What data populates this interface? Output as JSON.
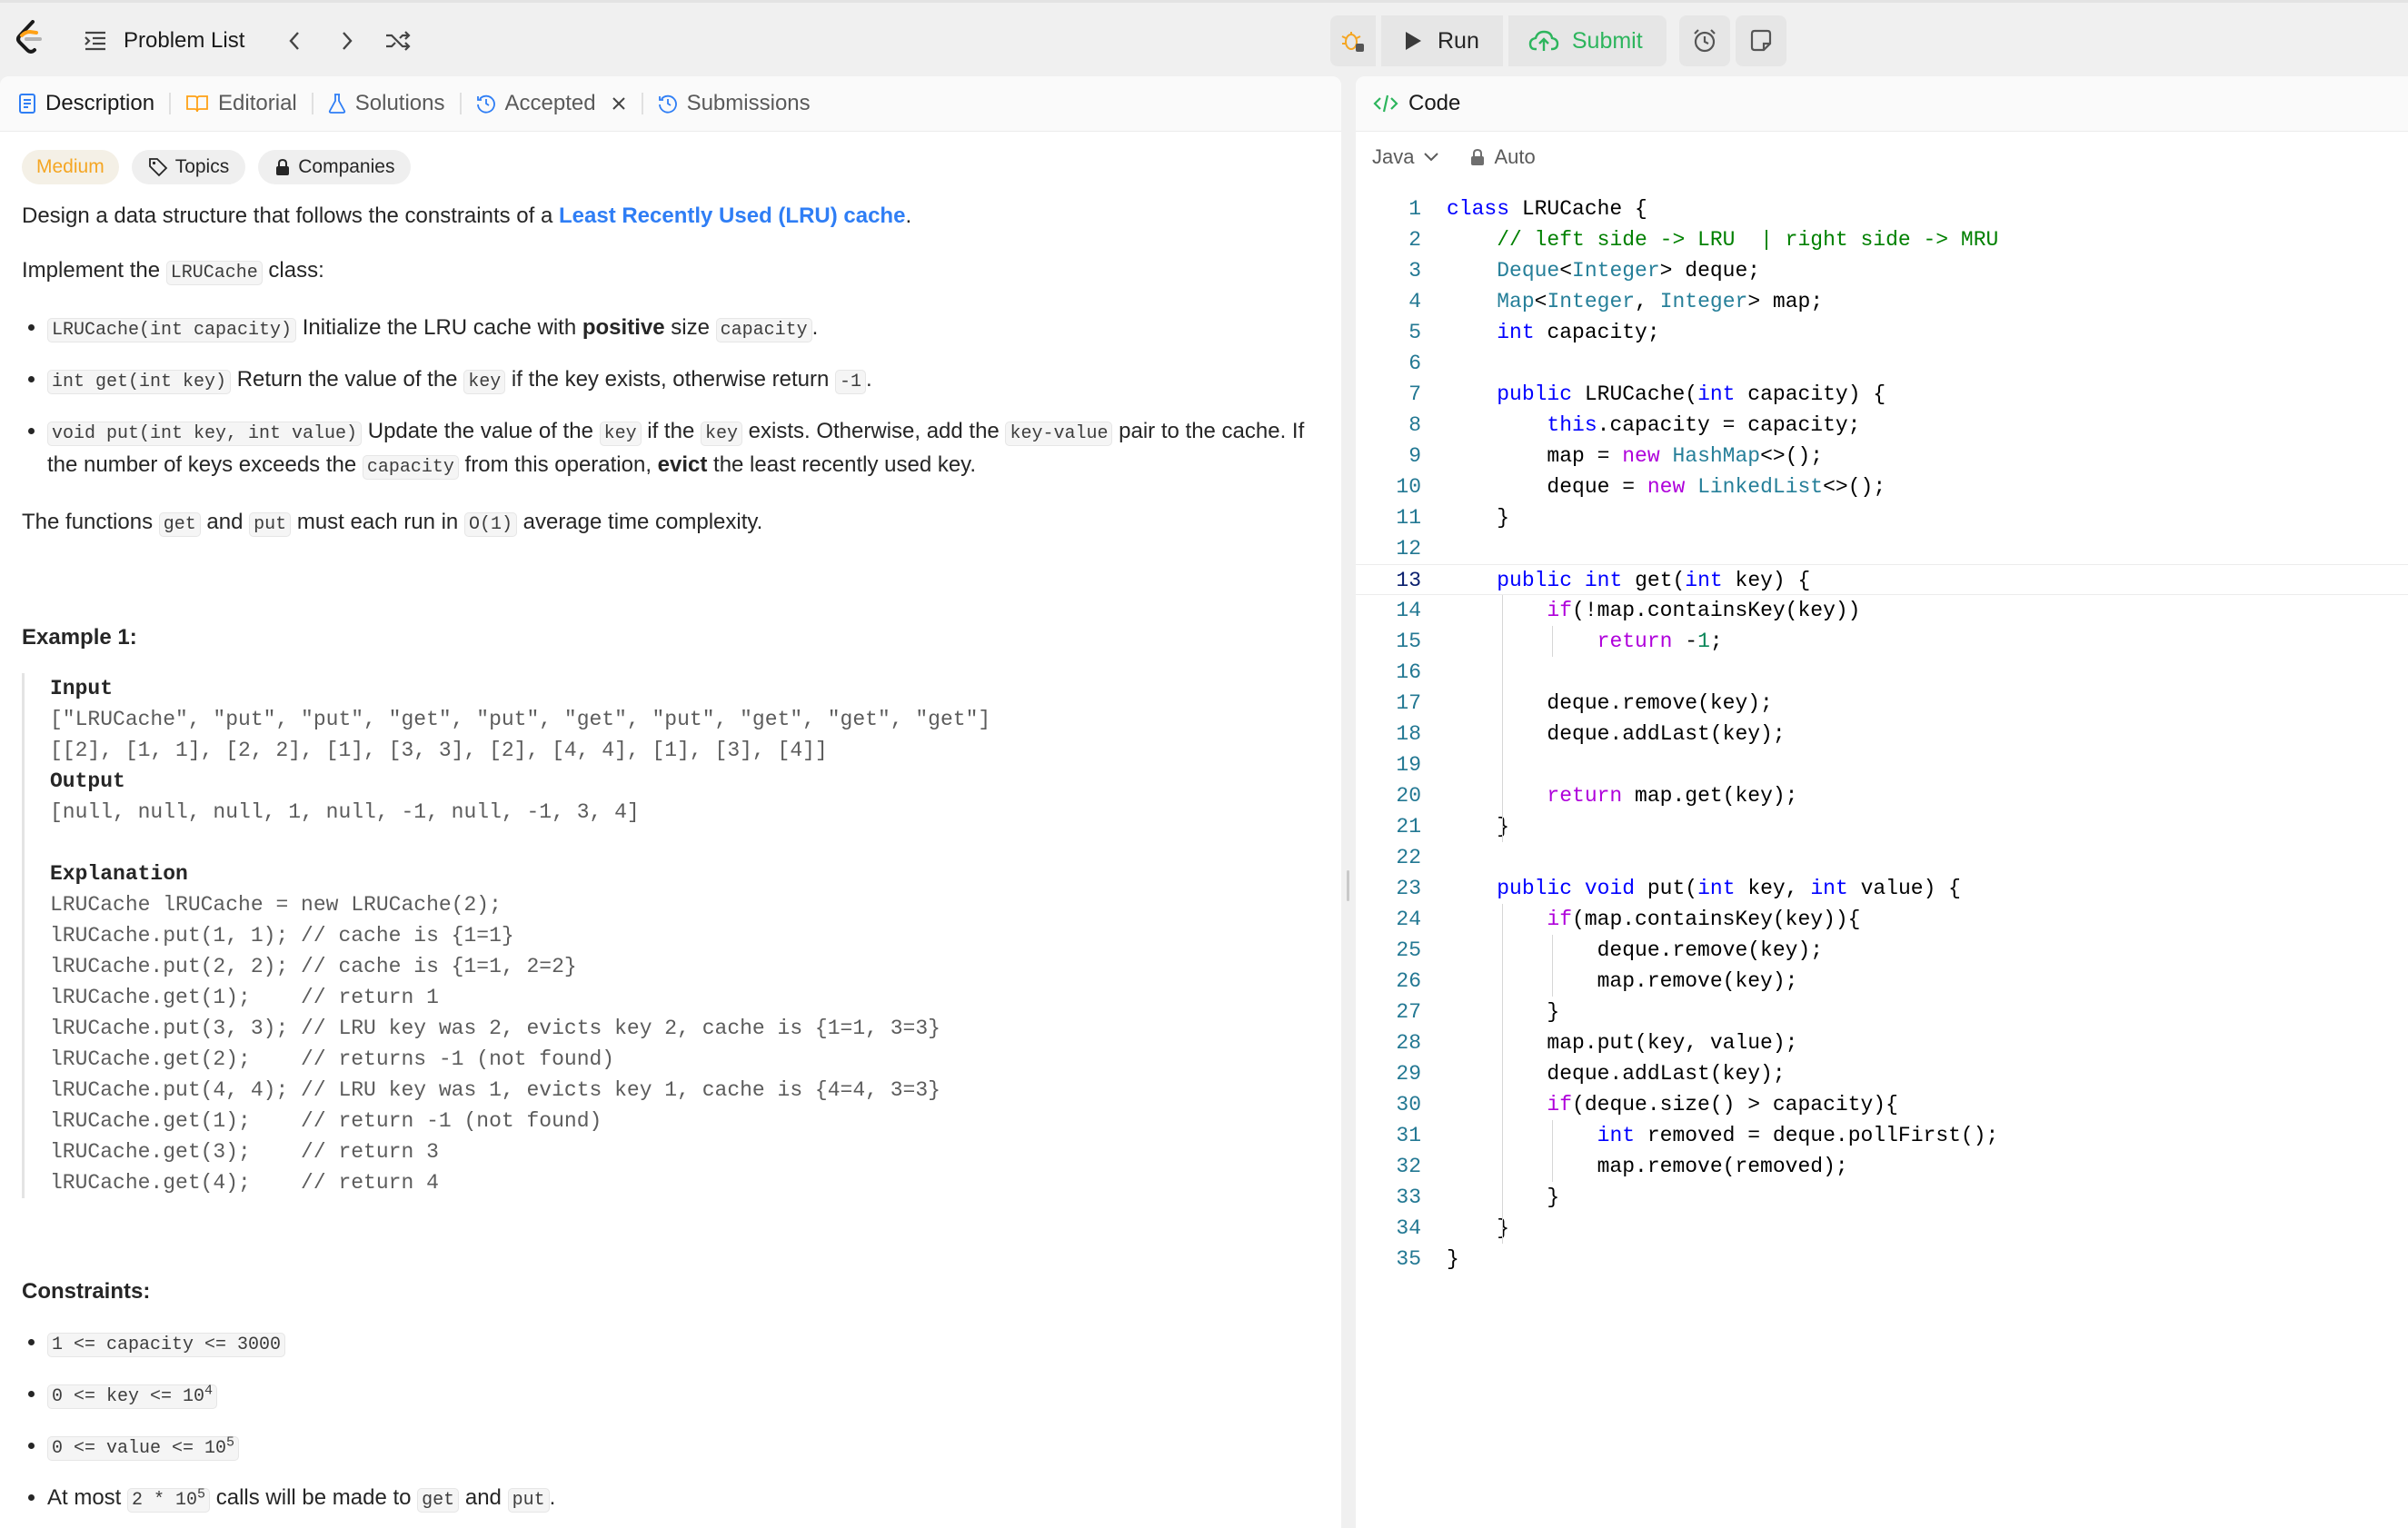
{
  "topbar": {
    "problem_list": "Problem List",
    "run": "Run",
    "submit": "Submit"
  },
  "tabs": {
    "description": "Description",
    "editorial": "Editorial",
    "solutions": "Solutions",
    "accepted": "Accepted",
    "submissions": "Submissions"
  },
  "chips": {
    "difficulty": "Medium",
    "topics": "Topics",
    "companies": "Companies"
  },
  "desc": {
    "p1_pre": "Design a data structure that follows the constraints of a ",
    "p1_link": "Least Recently Used (LRU) cache",
    "p1_post": ".",
    "p2_pre": "Implement the ",
    "p2_code": "LRUCache",
    "p2_post": " class:",
    "b1_code": "LRUCache(int capacity)",
    "b1_text1": " Initialize the LRU cache with ",
    "b1_bold": "positive",
    "b1_text2": " size ",
    "b1_code2": "capacity",
    "b1_end": ".",
    "b2_code": "int get(int key)",
    "b2_text1": " Return the value of the ",
    "b2_code2": "key",
    "b2_text2": " if the key exists, otherwise return ",
    "b2_code3": "-1",
    "b2_end": ".",
    "b3_code": "void put(int key, int value)",
    "b3_text1": " Update the value of the ",
    "b3_code2": "key",
    "b3_text2": " if the ",
    "b3_code3": "key",
    "b3_text3": " exists. Otherwise, add the ",
    "b3_code4": "key-value",
    "b3_text4": " pair to the cache. If the number of keys exceeds the ",
    "b3_code5": "capacity",
    "b3_text5": " from this operation, ",
    "b3_bold": "evict",
    "b3_text6": " the least recently used key.",
    "p3_pre": "The functions ",
    "p3_code1": "get",
    "p3_mid": " and ",
    "p3_code2": "put",
    "p3_mid2": " must each run in ",
    "p3_code3": "O(1)",
    "p3_post": " average time complexity."
  },
  "example": {
    "heading": "Example 1:",
    "input_label": "Input",
    "input_l1": "[\"LRUCache\", \"put\", \"put\", \"get\", \"put\", \"get\", \"put\", \"get\", \"get\", \"get\"]",
    "input_l2": "[[2], [1, 1], [2, 2], [1], [3, 3], [2], [4, 4], [1], [3], [4]]",
    "output_label": "Output",
    "output_l1": "[null, null, null, 1, null, -1, null, -1, 3, 4]",
    "explanation_label": "Explanation",
    "explanation": [
      "LRUCache lRUCache = new LRUCache(2);",
      "lRUCache.put(1, 1); // cache is {1=1}",
      "lRUCache.put(2, 2); // cache is {1=1, 2=2}",
      "lRUCache.get(1);    // return 1",
      "lRUCache.put(3, 3); // LRU key was 2, evicts key 2, cache is {1=1, 3=3}",
      "lRUCache.get(2);    // returns -1 (not found)",
      "lRUCache.put(4, 4); // LRU key was 1, evicts key 1, cache is {4=4, 3=3}",
      "lRUCache.get(1);    // return -1 (not found)",
      "lRUCache.get(3);    // return 3",
      "lRUCache.get(4);    // return 4"
    ]
  },
  "constraints": {
    "heading": "Constraints:",
    "c1": "1 <= capacity <= 3000",
    "c2_code": "0 <= key <= 10",
    "c2_sup": "4",
    "c3_code": "0 <= value <= 10",
    "c3_sup": "5",
    "c4_pre": "At most ",
    "c4_code": "2 * 10",
    "c4_sup": "5",
    "c4_mid": " calls will be made to ",
    "c4_code2": "get",
    "c4_and": " and ",
    "c4_code3": "put",
    "c4_end": "."
  },
  "editor": {
    "tab_label": "Code",
    "language": "Java",
    "mode": "Auto",
    "lines": [
      "class LRUCache {",
      "    // left side -> LRU  | right side -> MRU",
      "    Deque<Integer> deque;",
      "    Map<Integer, Integer> map;",
      "    int capacity;",
      "",
      "    public LRUCache(int capacity) {",
      "        this.capacity = capacity;",
      "        map = new HashMap<>();",
      "        deque = new LinkedList<>();",
      "    }",
      "",
      "    public int get(int key) {",
      "        if(!map.containsKey(key))",
      "            return -1;",
      "",
      "        deque.remove(key);",
      "        deque.addLast(key);",
      "",
      "        return map.get(key);",
      "    }",
      "",
      "    public void put(int key, int value) {",
      "        if(map.containsKey(key)){",
      "            deque.remove(key);",
      "            map.remove(key);",
      "        }",
      "        map.put(key, value);",
      "        deque.addLast(key);",
      "        if(deque.size() > capacity){",
      "            int removed = deque.pollFirst();",
      "            map.remove(removed);",
      "        }",
      "    }",
      "}"
    ],
    "current_line": 13
  }
}
